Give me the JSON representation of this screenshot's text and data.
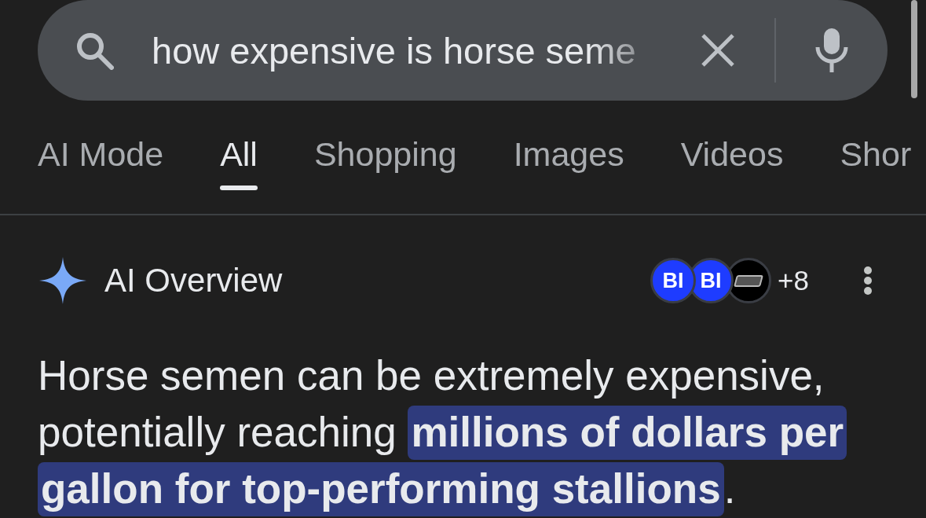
{
  "search": {
    "value": "how expensive is horse seme"
  },
  "tabs": [
    {
      "label": "AI Mode",
      "selected": false
    },
    {
      "label": "All",
      "selected": true
    },
    {
      "label": "Shopping",
      "selected": false
    },
    {
      "label": "Images",
      "selected": false
    },
    {
      "label": "Videos",
      "selected": false
    },
    {
      "label": "Shor",
      "selected": false
    }
  ],
  "ai_overview": {
    "title": "AI Overview",
    "sources": [
      {
        "kind": "letters",
        "label": "BI",
        "color": "#1e3cff"
      },
      {
        "kind": "letters",
        "label": "BI",
        "color": "#1e3cff"
      },
      {
        "kind": "mark",
        "color": "#000000"
      }
    ],
    "more_count": "+8",
    "answer": "Horse semen can be extremely expensive, potentially reaching **millions of dollars per gallon for top-performing stallions**."
  }
}
